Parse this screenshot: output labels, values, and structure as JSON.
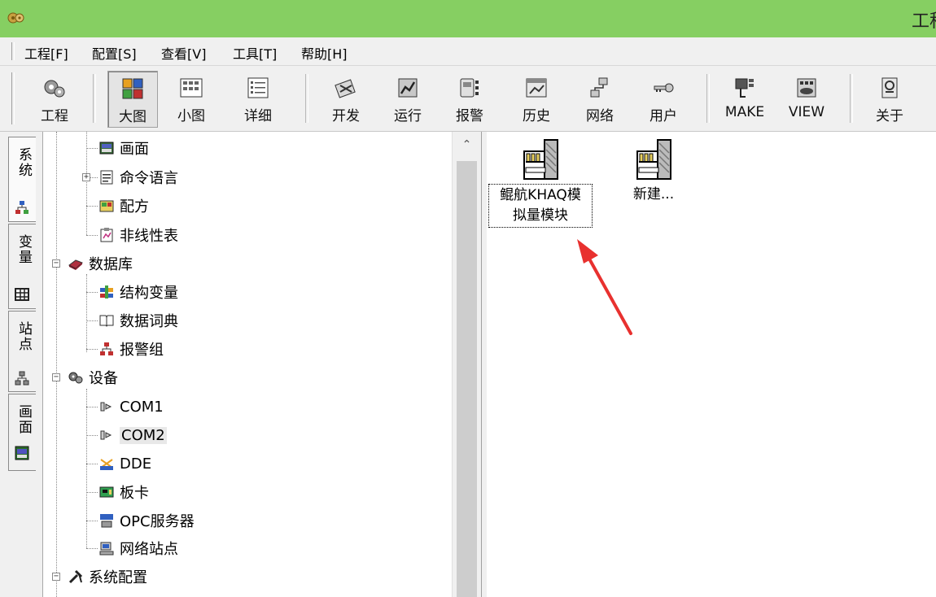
{
  "window": {
    "title": "工程"
  },
  "menu": [
    "工程[F]",
    "配置[S]",
    "查看[V]",
    "工具[T]",
    "帮助[H]"
  ],
  "toolbar": {
    "project": "工程",
    "large_icons": "大图",
    "small_icons": "小图",
    "details": "详细",
    "develop": "开发",
    "run": "运行",
    "alarm": "报警",
    "history": "历史",
    "network": "网络",
    "user": "用户",
    "make": "MAKE",
    "view": "VIEW",
    "about": "关于",
    "active_view": "大图"
  },
  "side_tabs": [
    "系统",
    "变量",
    "站点",
    "画面"
  ],
  "tree": {
    "screen": "画面",
    "command_language": "命令语言",
    "recipe": "配方",
    "nonlinear_table": "非线性表",
    "database": "数据库",
    "struct_vars": "结构变量",
    "data_dictionary": "数据词典",
    "alarm_group": "报警组",
    "devices": "设备",
    "com1": "COM1",
    "com2": "COM2",
    "dde": "DDE",
    "board": "板卡",
    "opc": "OPC服务器",
    "net_station": "网络站点",
    "system_config": "系统配置",
    "selected": "COM2"
  },
  "devices_pane": {
    "items": [
      {
        "line1": "鲲航KHAQ模",
        "line2": "拟量模块",
        "focused": true
      },
      {
        "line1": "新建...",
        "line2": "",
        "focused": false
      }
    ]
  },
  "colors": {
    "titlebar": "#86cf62",
    "arrow": "#e8312f",
    "tree_bg": "#ffffff",
    "chrome": "#f0f0f0"
  }
}
